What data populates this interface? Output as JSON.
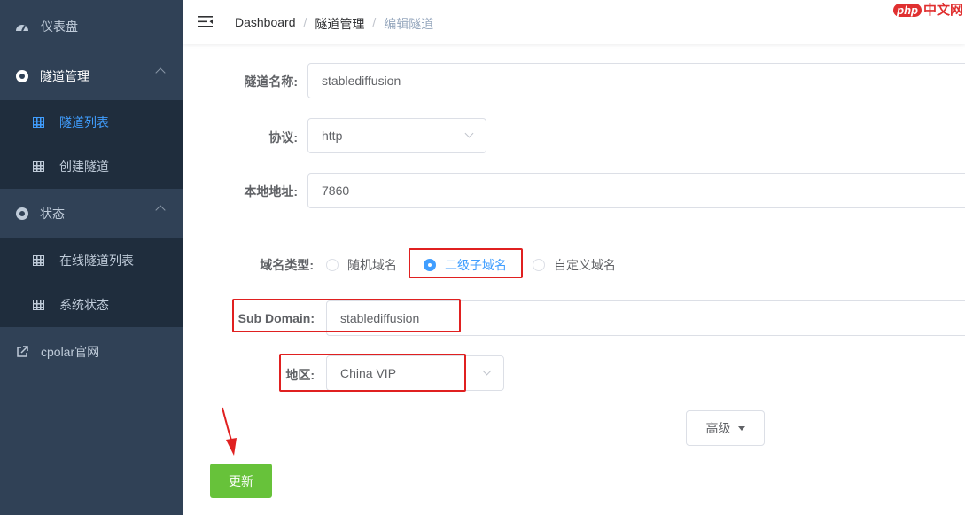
{
  "sidebar": {
    "dashboard": "仪表盘",
    "tunnel_mgmt": "隧道管理",
    "tunnel_list": "隧道列表",
    "create_tunnel": "创建隧道",
    "status": "状态",
    "online_tunnels": "在线隧道列表",
    "system_status": "系统状态",
    "cpolar_site": "cpolar官网"
  },
  "breadcrumb": {
    "home": "Dashboard",
    "section": "隧道管理",
    "current": "编辑隧道",
    "separator": "/"
  },
  "watermark": {
    "badge": "php",
    "text": "中文网"
  },
  "form": {
    "name_label": "隧道名称:",
    "name_value": "stablediffusion",
    "protocol_label": "协议:",
    "protocol_value": "http",
    "local_label": "本地地址:",
    "local_value": "7860",
    "domain_type_label": "域名类型:",
    "domain_options": [
      "随机域名",
      "二级子域名",
      "自定义域名"
    ],
    "domain_selected": "二级子域名",
    "subdomain_label": "Sub Domain:",
    "subdomain_value": "stablediffusion",
    "region_label": "地区:",
    "region_value": "China VIP",
    "advanced_button": "高级",
    "update_button": "更新"
  },
  "colors": {
    "sidebar_bg": "#304156",
    "submenu_bg": "#1f2d3d",
    "active": "#409eff",
    "highlight": "#e02020",
    "update_btn": "#67c23a"
  }
}
